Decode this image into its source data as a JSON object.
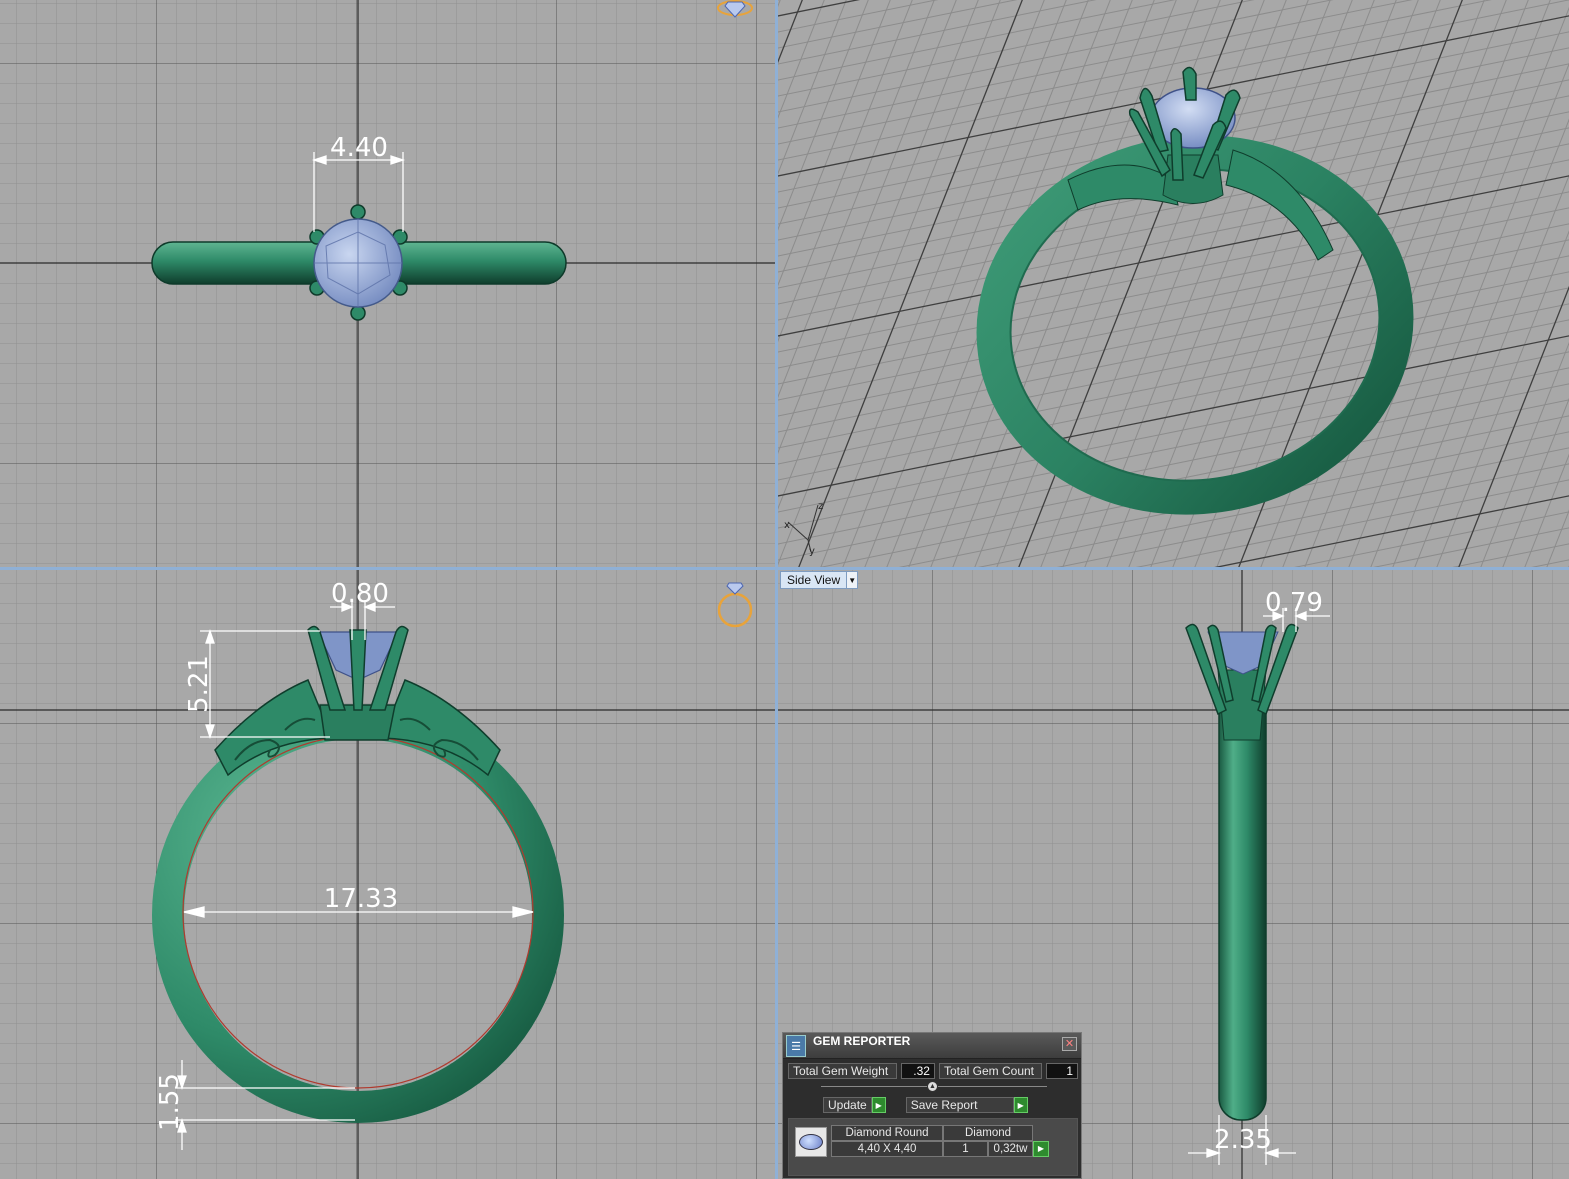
{
  "viewports": {
    "top": {
      "dimension_width": "4.40"
    },
    "perspective": {
      "axis_labels": [
        "x",
        "y",
        "z"
      ]
    },
    "front": {
      "dimension_prong": "0.80",
      "dimension_height": "5.21",
      "dimension_inner": "17.33",
      "dimension_band": "1.55"
    },
    "side": {
      "label": "Side View",
      "dimension_prong": "0.79",
      "dimension_band_width": "2.35"
    }
  },
  "gem_reporter": {
    "title": "GEM REPORTER",
    "total_weight_label": "Total Gem Weight",
    "total_weight_value": ".32",
    "total_count_label": "Total Gem Count",
    "total_count_value": "1",
    "update_label": "Update",
    "save_report_label": "Save Report",
    "gem": {
      "name": "Diamond Round",
      "size": "4,40 X 4,40",
      "material": "Diamond",
      "count": "1",
      "weight": "0,32tw"
    }
  },
  "colors": {
    "metal": "#2e8a68",
    "gem": "#8ea4d4",
    "grid_minor": "#8f8f8f",
    "grid_major": "#4d4d4d",
    "viewport_bg": "#a8a8a8",
    "separator": "#8fb0d6"
  },
  "icons": [
    "diamond-gizmo-icon",
    "ring-gizmo-icon",
    "gem-reporter-logo-icon",
    "close-icon",
    "play-icon",
    "dropdown-arrow-icon"
  ]
}
